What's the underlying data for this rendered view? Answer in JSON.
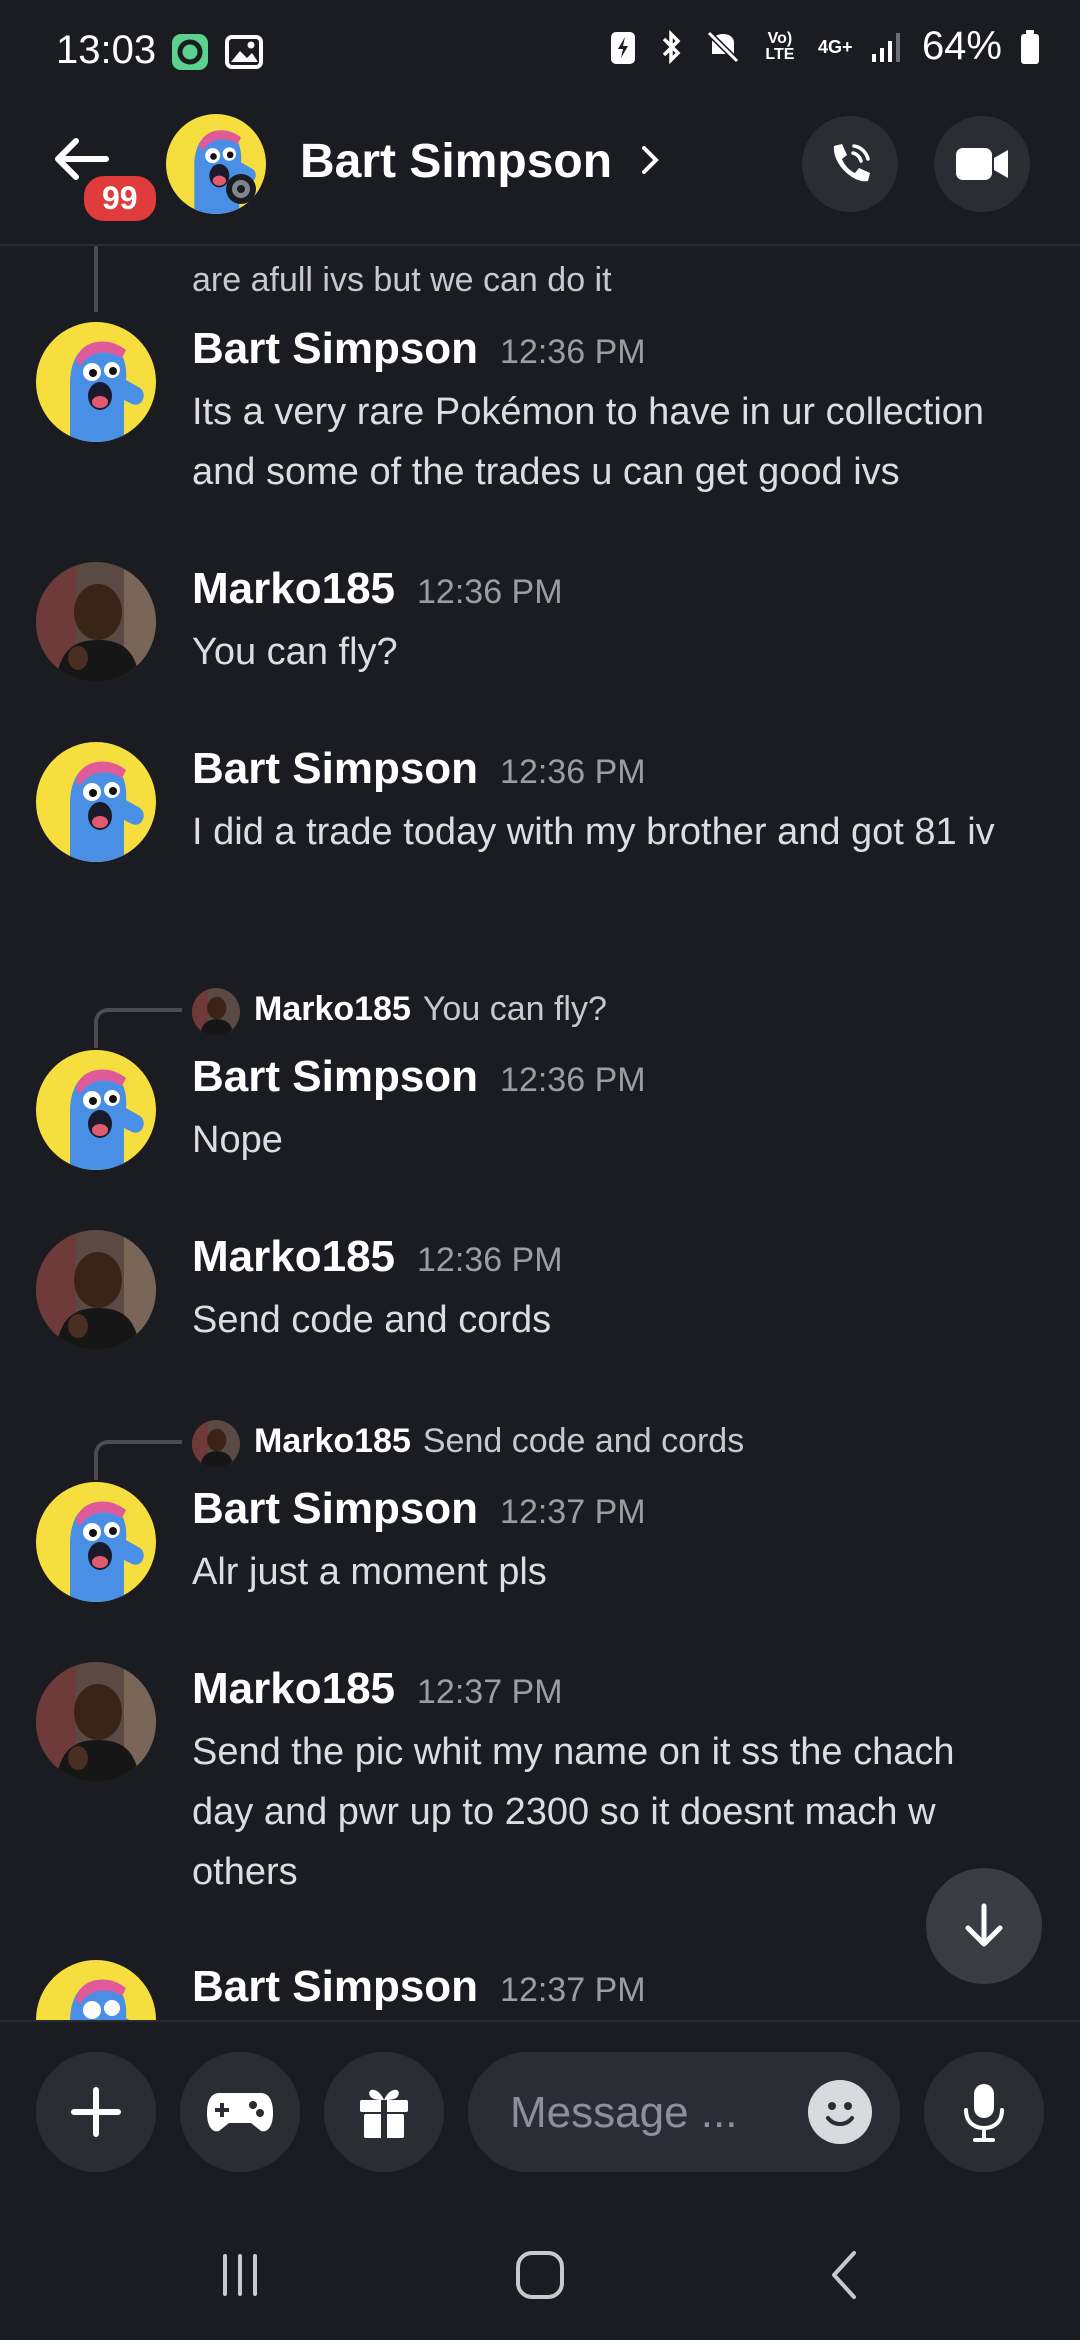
{
  "status_bar": {
    "time": "13:03",
    "network_label": "Vo) LTE",
    "network_gen": "4G+",
    "battery": "64%"
  },
  "header": {
    "title": "Bart Simpson",
    "unread_badge": "99",
    "icons": [
      "back-arrow-icon",
      "phone-call-icon",
      "video-camera-icon"
    ]
  },
  "messages": {
    "partial_top": "are afull ivs but we can do it",
    "m1": {
      "author": "Bart Simpson",
      "time": "12:36 PM",
      "text": "Its a very rare Pokémon to have in ur collection and some of the trades u can get good ivs"
    },
    "m2": {
      "author": "Marko185",
      "time": "12:36 PM",
      "text": "You can fly?"
    },
    "m3": {
      "author": "Bart Simpson",
      "time": "12:36 PM",
      "text": "I did a trade today with my brother and got 81 iv"
    },
    "r4": {
      "author": "Marko185",
      "text": "You can fly?"
    },
    "m4": {
      "author": "Bart Simpson",
      "time": "12:36 PM",
      "text": "Nope"
    },
    "m5": {
      "author": "Marko185",
      "time": "12:36 PM",
      "text": "Send code and cords"
    },
    "r6": {
      "author": "Marko185",
      "text": "Send code and cords"
    },
    "m6": {
      "author": "Bart Simpson",
      "time": "12:37 PM",
      "text": "Alr just a moment pls"
    },
    "m7": {
      "author": "Marko185",
      "time": "12:37 PM",
      "text": "Send the pic whit my name on it ss the chach day and pwr up to 2300 so it doesnt mach w others"
    },
    "m8": {
      "author": "Bart Simpson",
      "time": "12:37 PM"
    }
  },
  "composer": {
    "placeholder": "Message ...",
    "icons": [
      "plus-icon",
      "gamepad-icon",
      "gift-icon",
      "emoji-icon",
      "microphone-icon"
    ]
  },
  "colors": {
    "background": "#1b1c22",
    "button_bg": "#2b2d34",
    "badge": "#e03c3c",
    "timestamp": "#9a9ca6",
    "bart_avatar_bg": "#f5de3e",
    "bart_body": "#4a8fe6"
  }
}
